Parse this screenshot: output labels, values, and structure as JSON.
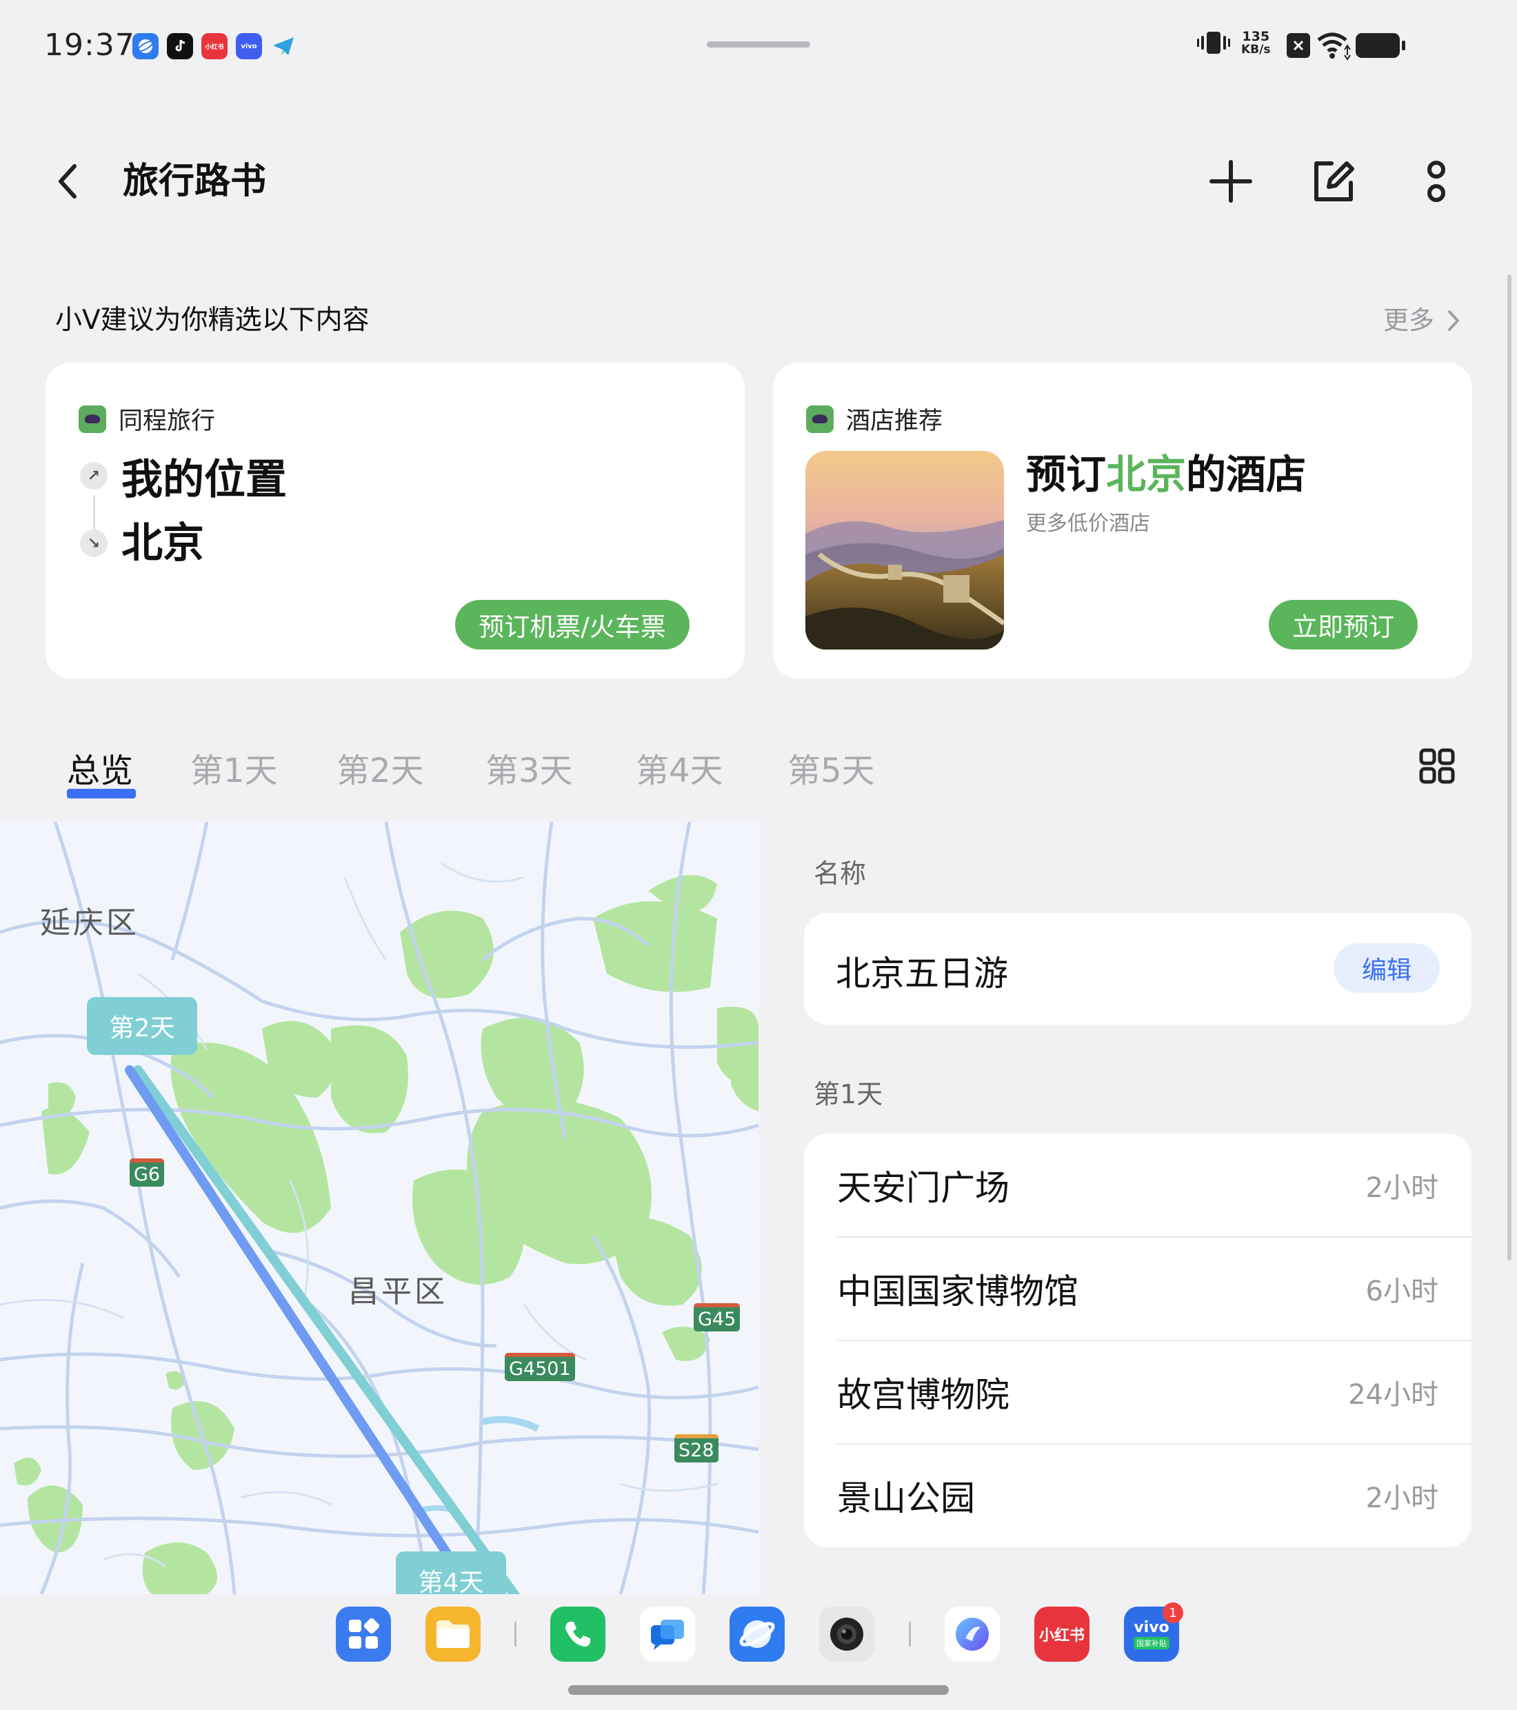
{
  "status_bar": {
    "time": "19:37",
    "net_speed_value": "135",
    "net_speed_unit": "KB/s",
    "notification_icons": [
      "browser-icon",
      "tiktok-icon",
      "xiaohongshu-icon",
      "vivo-icon",
      "telegram-icon"
    ],
    "xiaohongshu_label": "小红书",
    "vivo_label": "vivo"
  },
  "header": {
    "title": "旅行路书"
  },
  "suggestions": {
    "title": "小V建议为你精选以下内容",
    "more_label": "更多",
    "travel_card": {
      "source": "同程旅行",
      "from": "我的位置",
      "to": "北京",
      "button": "预订机票/火车票"
    },
    "hotel_card": {
      "source": "酒店推荐",
      "title_prefix": "预订",
      "title_highlight": "北京",
      "title_suffix": "的酒店",
      "subtitle": "更多低价酒店",
      "button": "立即预订"
    }
  },
  "tabs": [
    "总览",
    "第1天",
    "第2天",
    "第3天",
    "第4天",
    "第5天"
  ],
  "active_tab": "总览",
  "map": {
    "district_labels": [
      "延庆区",
      "昌平区"
    ],
    "road_signs": [
      "G6",
      "G45",
      "G4501",
      "S28"
    ],
    "day_pins": [
      "第2天",
      "第4天"
    ]
  },
  "itinerary": {
    "name_label": "名称",
    "trip_name": "北京五日游",
    "edit_label": "编辑",
    "day_label": "第1天",
    "pois": [
      {
        "name": "天安门广场",
        "duration": "2小时"
      },
      {
        "name": "中国国家博物馆",
        "duration": "6小时"
      },
      {
        "name": "故宫博物院",
        "duration": "24小时"
      },
      {
        "name": "景山公园",
        "duration": "2小时"
      }
    ]
  },
  "dock": {
    "apps": [
      "app-store-icon",
      "files-icon",
      "phone-icon",
      "messages-icon",
      "browser-icon",
      "camera-icon",
      "jovi-icon",
      "xiaohongshu-icon",
      "vivo-subsidy-icon"
    ],
    "xiaohongshu_label": "小红书",
    "vivo_label": "vivo",
    "vivo_sub_label": "国家补贴",
    "vivo_badge": "1"
  },
  "colors": {
    "accent_green": "#5bb55b",
    "accent_blue": "#3b6ff5",
    "route_teal": "#7fcfd4",
    "route_blue": "#6f9bf2"
  }
}
